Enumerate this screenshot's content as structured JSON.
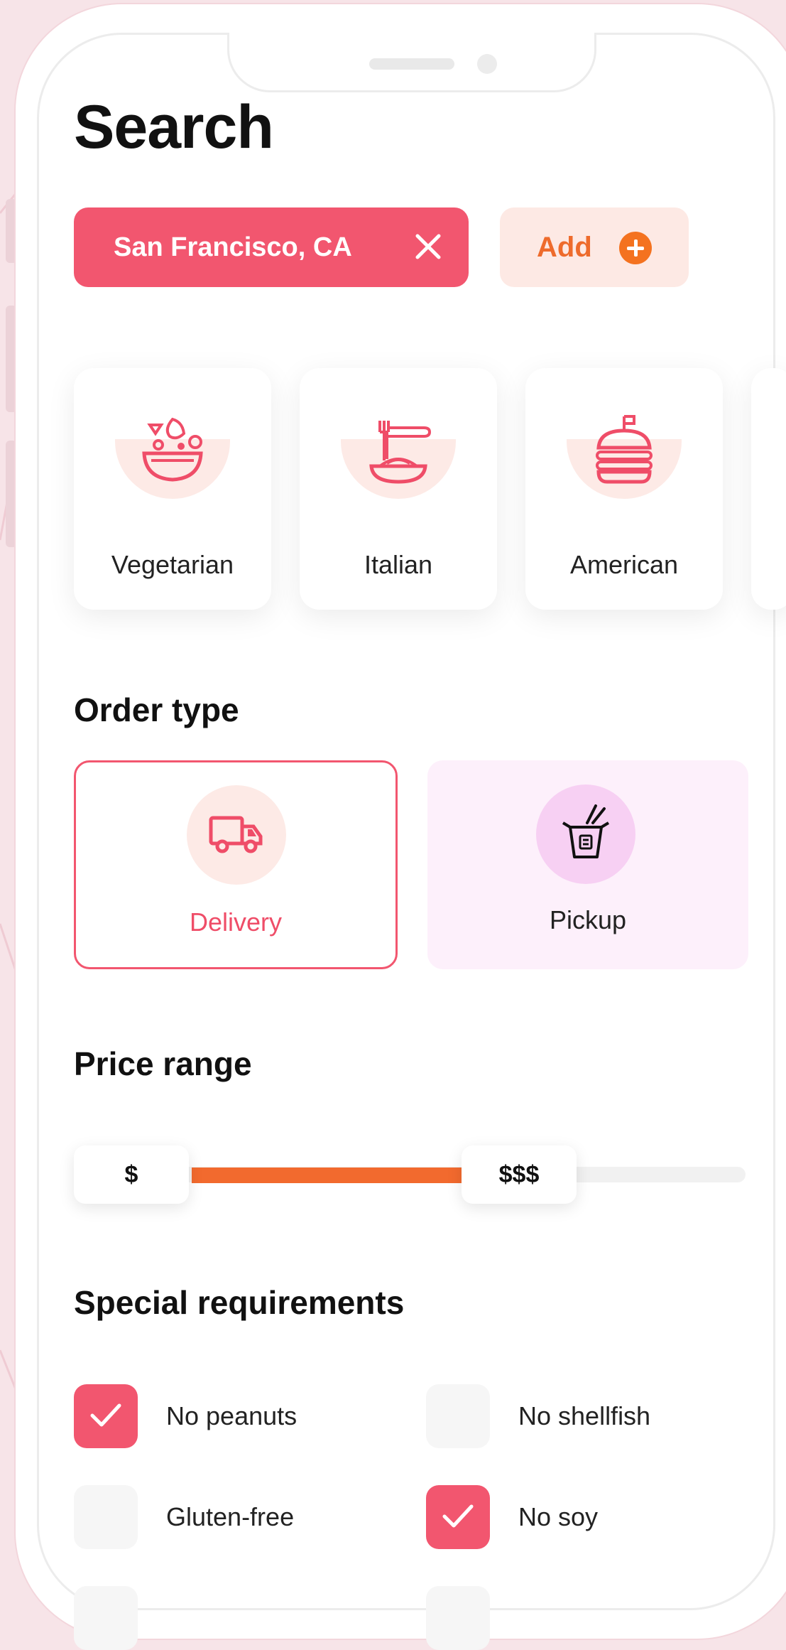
{
  "title": "Search",
  "location_chip": {
    "label": "San Francisco, CA"
  },
  "add_chip": {
    "label": "Add"
  },
  "categories": [
    {
      "label": "Vegetarian",
      "icon": "salad-bowl-icon"
    },
    {
      "label": "Italian",
      "icon": "spaghetti-icon"
    },
    {
      "label": "American",
      "icon": "burger-icon"
    }
  ],
  "order_type": {
    "heading": "Order type",
    "options": [
      {
        "label": "Delivery",
        "icon": "delivery-truck-icon",
        "selected": true
      },
      {
        "label": "Pickup",
        "icon": "takeout-box-icon",
        "selected": false
      }
    ]
  },
  "price_range": {
    "heading": "Price range",
    "min_label": "$",
    "max_label": "$$$"
  },
  "special_requirements": {
    "heading": "Special requirements",
    "items": [
      {
        "label": "No peanuts",
        "checked": true
      },
      {
        "label": "No shellfish",
        "checked": false
      },
      {
        "label": "Gluten-free",
        "checked": false
      },
      {
        "label": "No soy",
        "checked": true
      }
    ]
  },
  "colors": {
    "accent": "#f2566f",
    "orange": "#f26a2e",
    "pickup_bg": "#fdf0fb"
  }
}
